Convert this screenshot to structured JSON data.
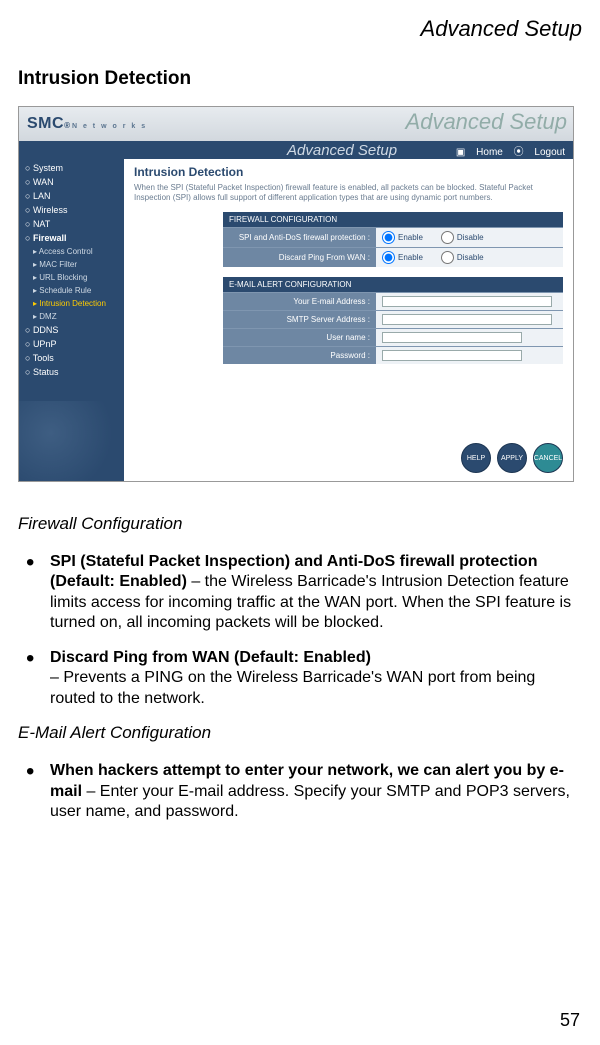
{
  "doc_header": "Advanced Setup",
  "section_heading": "Intrusion Detection",
  "screenshot": {
    "watermark": "Advanced Setup",
    "logo": {
      "main": "SMC",
      "reg": "®",
      "sub": "N e t w o r k s"
    },
    "toolbar": {
      "title": "Advanced Setup",
      "home": "Home",
      "logout": "Logout"
    },
    "sidebar": {
      "items": [
        {
          "label": "System",
          "type": "top"
        },
        {
          "label": "WAN",
          "type": "top"
        },
        {
          "label": "LAN",
          "type": "top"
        },
        {
          "label": "Wireless",
          "type": "top"
        },
        {
          "label": "NAT",
          "type": "top"
        },
        {
          "label": "Firewall",
          "type": "expanded"
        },
        {
          "label": "Access Control",
          "type": "sub"
        },
        {
          "label": "MAC Filter",
          "type": "sub"
        },
        {
          "label": "URL Blocking",
          "type": "sub"
        },
        {
          "label": "Schedule Rule",
          "type": "sub"
        },
        {
          "label": "Intrusion Detection",
          "type": "sub-active"
        },
        {
          "label": "DMZ",
          "type": "sub"
        },
        {
          "label": "DDNS",
          "type": "top"
        },
        {
          "label": "UPnP",
          "type": "top"
        },
        {
          "label": "Tools",
          "type": "top"
        },
        {
          "label": "Status",
          "type": "top"
        }
      ]
    },
    "content": {
      "title": "Intrusion Detection",
      "desc": "When the SPI (Stateful Packet Inspection) firewall feature is enabled, all packets can be blocked. Stateful Packet Inspection (SPI) allows full support of different application types that are using dynamic port numbers.",
      "firewall_header": "FIREWALL CONFIGURATION",
      "row_spi": "SPI and Anti-DoS firewall protection :",
      "row_ping": "Discard Ping From WAN :",
      "enable_label": "Enable",
      "disable_label": "Disable",
      "email_header": "E-MAIL ALERT CONFIGURATION",
      "row_email": "Your E-mail Address :",
      "row_smtp": "SMTP Server Address :",
      "row_user": "User name :",
      "row_pass": "Password :",
      "btn_help": "HELP",
      "btn_apply": "APPLY",
      "btn_cancel": "CANCEL"
    }
  },
  "subhead_firewall": "Firewall Configuration",
  "bullets_firewall": [
    {
      "bold": "SPI (Stateful Packet Inspection) and Anti-DoS firewall protection (Default: Enabled)",
      "rest": " – the Wireless Barricade's Intrusion Detection feature limits access for incoming traffic at the WAN port. When the SPI feature is turned on, all incoming packets will be blocked."
    },
    {
      "bold": "Discard Ping from WAN (Default: Enabled)",
      "rest_br": "– Prevents a PING on the Wireless Barricade's WAN port from being routed to the network."
    }
  ],
  "subhead_email": "E-Mail Alert Configuration",
  "bullets_email": [
    {
      "bold": "When hackers attempt to enter your network, we can alert you by e-mail",
      "rest": " – Enter your E-mail address. Specify your SMTP and POP3 servers, user name, and password."
    }
  ],
  "page_number": "57"
}
